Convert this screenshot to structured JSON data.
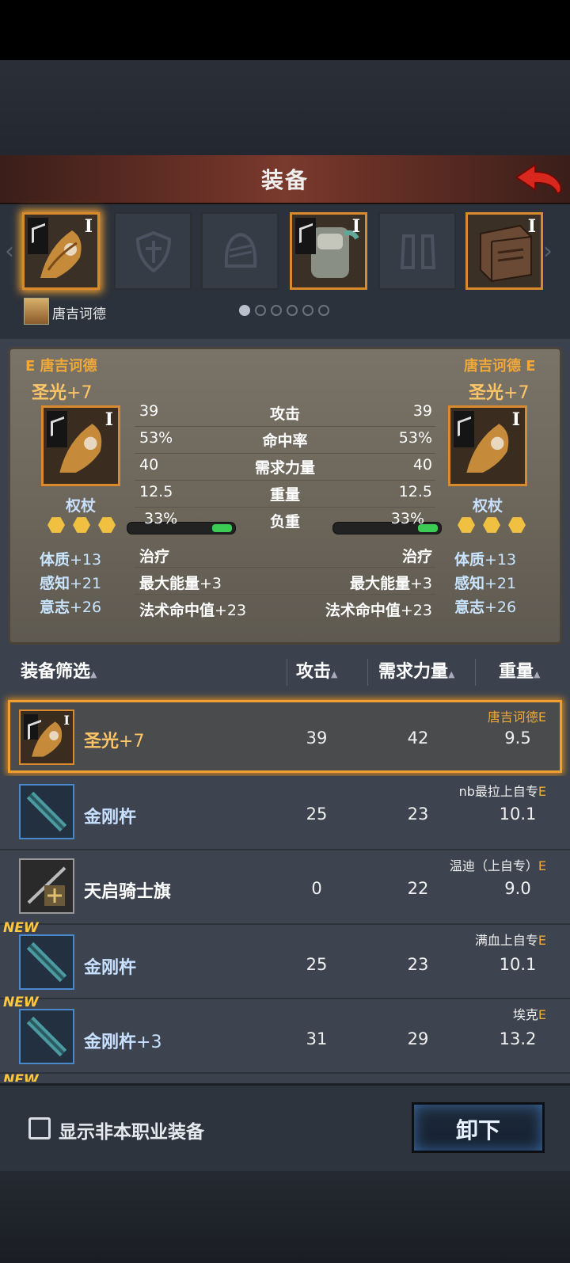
{
  "header": {
    "title": "装备"
  },
  "hero": {
    "name": "唐吉诃德"
  },
  "slots": [
    {
      "roman": "I"
    },
    {
      "roman": ""
    },
    {
      "roman": ""
    },
    {
      "roman": "I"
    },
    {
      "roman": ""
    },
    {
      "roman": "I"
    }
  ],
  "page_dots": {
    "count": 6,
    "active": 0
  },
  "compare": {
    "left": {
      "owner_grade": "E",
      "owner": "唐吉诃德",
      "name": "圣光",
      "enhance": "+7",
      "roman": "I",
      "type": "权杖",
      "stars": 3
    },
    "right": {
      "owner": "唐吉诃德",
      "owner_grade": "E",
      "name": "圣光",
      "enhance": "+7",
      "roman": "I",
      "type": "权杖",
      "stars": 3
    },
    "stats": [
      {
        "label": "攻击",
        "left": "39",
        "right": "39"
      },
      {
        "label": "命中率",
        "left": "53%",
        "right": "53%"
      },
      {
        "label": "需求力量",
        "left": "40",
        "right": "40"
      },
      {
        "label": "重量",
        "left": "12.5",
        "right": "12.5"
      }
    ],
    "load": {
      "label": "负重",
      "left": "33%",
      "right": "33%",
      "value": 0.33
    },
    "attrs": [
      {
        "name": "体质",
        "value": "+13"
      },
      {
        "name": "感知",
        "value": "+21"
      },
      {
        "name": "意志",
        "value": "+26"
      }
    ],
    "effects": [
      {
        "name": "治疗",
        "value": ""
      },
      {
        "name": "最大能量",
        "value": "+3"
      },
      {
        "name": "法术命中值",
        "value": "+23"
      }
    ]
  },
  "filter": {
    "label": "装备筛选",
    "col_attack": "攻击",
    "col_strength": "需求力量",
    "col_weight": "重量"
  },
  "list": [
    {
      "name": "圣光",
      "enhance": "+7",
      "attack": "39",
      "strength": "42",
      "weight": "9.5",
      "owner": "唐吉诃德",
      "grade": "E",
      "new": "",
      "selected": true,
      "roman": "I"
    },
    {
      "name": "金刚杵",
      "enhance": "",
      "attack": "25",
      "strength": "23",
      "weight": "10.1",
      "owner": "nb最拉上自专",
      "grade": "E",
      "new": ""
    },
    {
      "name": "天启骑士旗",
      "enhance": "",
      "attack": "0",
      "strength": "22",
      "weight": "9.0",
      "owner": "温迪（上自专）",
      "grade": "E",
      "new": ""
    },
    {
      "name": "金刚杵",
      "enhance": "",
      "attack": "25",
      "strength": "23",
      "weight": "10.1",
      "owner": "满血上自专",
      "grade": "E",
      "new": "NEW"
    },
    {
      "name": "金刚杵",
      "enhance": "+3",
      "attack": "31",
      "strength": "29",
      "weight": "13.2",
      "owner": "埃克",
      "grade": "E",
      "new": "NEW"
    }
  ],
  "next_row_badge": "NEW",
  "bottom": {
    "checkbox_label": "显示非本职业装备",
    "unequip_label": "卸下"
  },
  "colors": {
    "accent": "#f0a030",
    "header": "#6e3328",
    "panel": "#3b424d"
  }
}
